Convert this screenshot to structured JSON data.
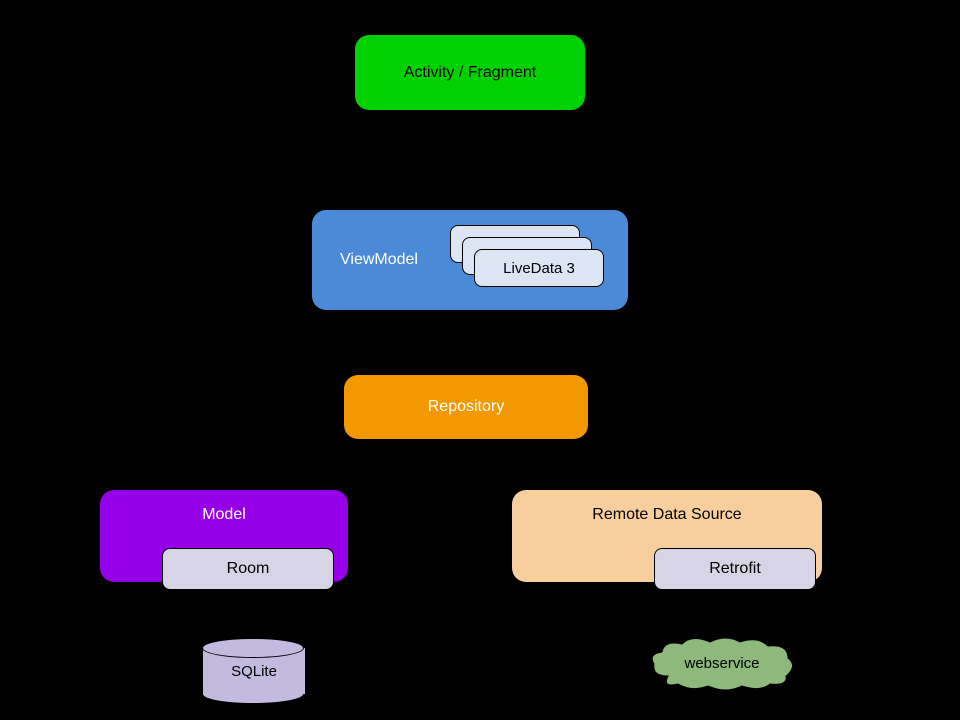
{
  "nodes": {
    "activity": "Activity / Fragment",
    "viewmodel": "ViewModel",
    "livedata": "LiveData 3",
    "repository": "Repository",
    "model": "Model",
    "room": "Room",
    "remote": "Remote Data Source",
    "retrofit": "Retrofit",
    "sqlite": "SQLite",
    "webservice": "webservice"
  },
  "colors": {
    "activity": "#00d200",
    "viewmodel": "#4a8ad6",
    "livedata": "#dbe5f3",
    "repository": "#f29800",
    "model": "#9600e6",
    "sub": "#d7d4e6",
    "remote": "#f7cf9d",
    "cylinder": "#c3bbdd",
    "cloud": "#8fb87c"
  }
}
